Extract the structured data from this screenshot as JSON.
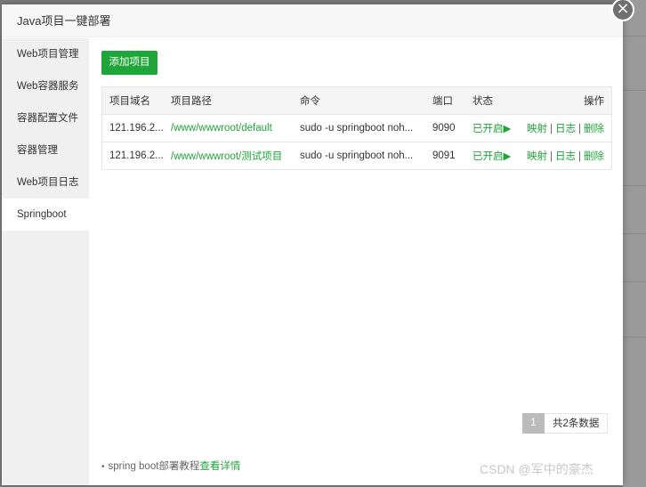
{
  "modal": {
    "title": "Java项目一键部署",
    "close_icon": "×"
  },
  "sidebar": {
    "items": [
      {
        "label": "Web项目管理"
      },
      {
        "label": "Web容器服务"
      },
      {
        "label": "容器配置文件"
      },
      {
        "label": "容器管理"
      },
      {
        "label": "Web项目日志"
      },
      {
        "label": "Springboot"
      }
    ],
    "active_index": 5
  },
  "toolbar": {
    "add_label": "添加项目"
  },
  "table": {
    "headers": {
      "domain": "项目域名",
      "path": "项目路径",
      "command": "命令",
      "port": "端口",
      "status": "状态",
      "ops": "操作"
    },
    "rows": [
      {
        "domain": "121.196.2...",
        "path": "/www/wwwroot/default",
        "command": "sudo -u springboot noh...",
        "port": "9090",
        "status": "已开启▶",
        "op_map": "映射",
        "op_log": "日志",
        "op_delete": "删除"
      },
      {
        "domain": "121.196.2...",
        "path": "/www/wwwroot/测试项目",
        "command": "sudo -u springboot noh...",
        "port": "9091",
        "status": "已开启▶",
        "op_map": "映射",
        "op_log": "日志",
        "op_delete": "删除"
      }
    ],
    "separator": "|"
  },
  "pager": {
    "current": "1",
    "total_text": "共2条数据"
  },
  "footnote": {
    "bullet": "•",
    "text": "spring boot部署教程",
    "link": "查看详情"
  },
  "watermark": "CSDN @军中的豪杰",
  "colors": {
    "accent": "#20a53a",
    "sidebar_bg": "#f0f0f0",
    "header_bg": "#f7f7f7"
  }
}
